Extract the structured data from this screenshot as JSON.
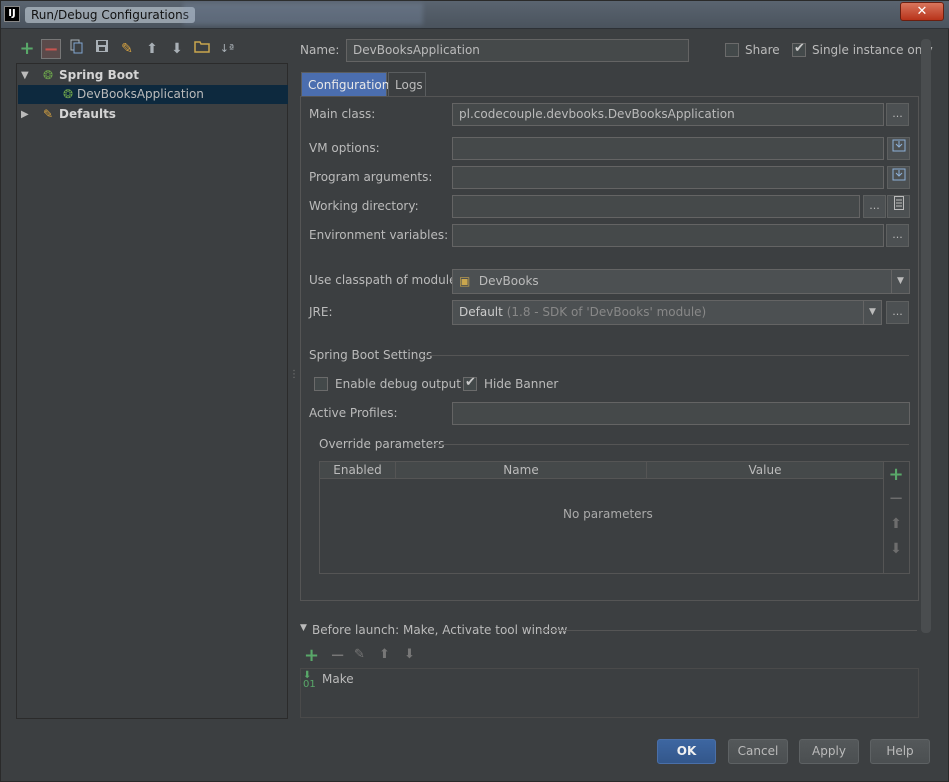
{
  "window": {
    "title": "Run/Debug Configurations",
    "app_icon": "IJ",
    "close_glyph": "✕"
  },
  "left_toolbar": {
    "icons": [
      "add-icon",
      "remove-icon",
      "copy-icon",
      "save-icon",
      "wrench-icon",
      "arrow-up-icon",
      "arrow-down-icon",
      "folder-icon",
      "sort-icon"
    ]
  },
  "tree": {
    "spring_boot": "Spring Boot",
    "dev_books_app": "DevBooksApplication",
    "defaults": "Defaults"
  },
  "header": {
    "name_label": "Name:",
    "name_value": "DevBooksApplication",
    "share_label": "Share",
    "single_instance_label": "Single instance only",
    "share_checked": false,
    "single_instance_checked": true
  },
  "tabs": {
    "configuration": "Configuration",
    "logs": "Logs"
  },
  "config": {
    "main_class_label": "Main class:",
    "main_class_value": "pl.codecouple.devbooks.DevBooksApplication",
    "vm_options_label": "VM options:",
    "program_args_label": "Program arguments:",
    "working_dir_label": "Working directory:",
    "env_vars_label": "Environment variables:",
    "classpath_label": "Use classpath of module:",
    "classpath_value": "DevBooks",
    "jre_label": "JRE:",
    "jre_value": "Default",
    "jre_detail": "(1.8 - SDK of 'DevBooks' module)",
    "ellipsis": "..."
  },
  "spring_boot_settings": {
    "heading": "Spring Boot Settings",
    "enable_debug_label": "Enable debug output",
    "hide_banner_label": "Hide Banner",
    "enable_debug_checked": false,
    "hide_banner_checked": true,
    "active_profiles_label": "Active Profiles:"
  },
  "override": {
    "heading": "Override parameters",
    "columns": [
      "Enabled",
      "Name",
      "Value"
    ],
    "empty_text": "No parameters"
  },
  "before_launch": {
    "heading": "Before launch: Make, Activate tool window",
    "items": [
      "Make"
    ]
  },
  "buttons": {
    "ok": "OK",
    "cancel": "Cancel",
    "apply": "Apply",
    "help": "Help"
  },
  "colors": {
    "accent": "#4b6eaf",
    "background": "#3c3f41",
    "add_green": "#59a869"
  }
}
